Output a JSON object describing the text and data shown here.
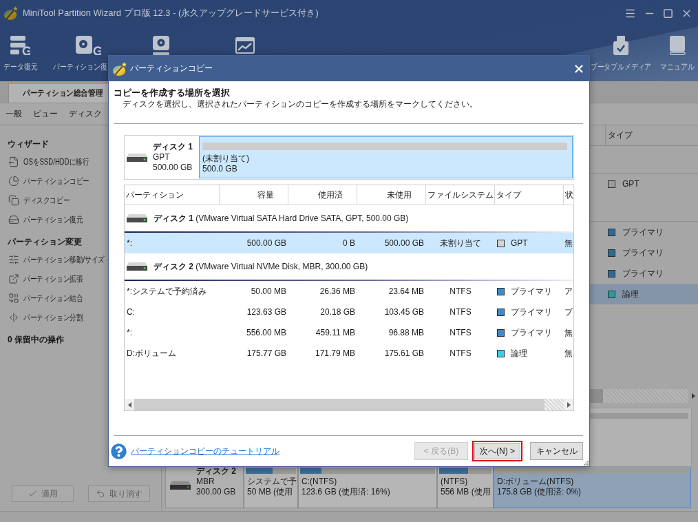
{
  "window": {
    "title": "MiniTool Partition Wizard プロ版 12.3 - (永久アップグレードサービス付き)"
  },
  "toolbar": {
    "left": [
      {
        "label": "データ復元"
      },
      {
        "label": "パーティション復"
      }
    ],
    "right": [
      {
        "label": "ブータブルメディア"
      },
      {
        "label": "マニュアル"
      }
    ]
  },
  "tabs": [
    {
      "label": "パーティション総合管理",
      "selected": true
    }
  ],
  "menu": [
    {
      "label": "一般"
    },
    {
      "label": "ビュー"
    },
    {
      "label": "ディスク"
    }
  ],
  "sidebar": {
    "sections": [
      {
        "title": "ウィザード",
        "items": [
          {
            "label": "OSをSSD/HDDに移行"
          },
          {
            "label": "パーティションコピー"
          },
          {
            "label": "ディスクコピー"
          },
          {
            "label": "パーティション復元"
          }
        ]
      },
      {
        "title": "パーティション変更",
        "items": [
          {
            "label": "パーティション移動/サイズ"
          },
          {
            "label": "パーティション拡張"
          },
          {
            "label": "パーティション結合"
          },
          {
            "label": "パーティション分割"
          }
        ]
      },
      {
        "title": "0 保留中の操作"
      }
    ],
    "actions": [
      {
        "label": "適用",
        "disabled": true
      },
      {
        "label": "取り消す",
        "disabled": true
      }
    ]
  },
  "partition_list": {
    "columns": [
      {
        "label": "タイプ"
      }
    ],
    "rows": [
      {
        "kind": "disk"
      },
      {
        "kind": "partition",
        "type": "GPT",
        "color": "#9c9c9c",
        "selected": false
      },
      {
        "kind": "disk"
      },
      {
        "kind": "partition",
        "type": "プライマリ",
        "color": "#2d6a94",
        "selected": false
      },
      {
        "kind": "partition",
        "type": "プライマリ",
        "color": "#2d6a94",
        "selected": false
      },
      {
        "kind": "partition",
        "type": "プライマリ",
        "color": "#2d6a94",
        "selected": false
      },
      {
        "kind": "partition",
        "type": "論理",
        "color": "#2a99a6",
        "selected": true
      }
    ]
  },
  "disk_map": {
    "disks": [
      {
        "partitions": [
          {
            "selected": false
          }
        ]
      },
      {
        "name": "ディスク 2",
        "scheme": "MBR",
        "size": "300.00 GB",
        "partitions": [
          {
            "label": "システムで予",
            "detail": "50 MB (使用",
            "level": 0.53,
            "selected": false
          },
          {
            "label": "C:(NTFS)",
            "detail": "123.6 GB (使用済: 16%)",
            "level": 0.16,
            "selected": false
          },
          {
            "label": "(NTFS)",
            "detail": "556 MB (使用",
            "level": 0.55,
            "selected": false
          },
          {
            "label": "D:ボリューム(NTFS)",
            "detail": "175.8 GB (使用済: 0%)",
            "selected": true
          }
        ]
      }
    ]
  },
  "dialog": {
    "title": "パーティションコピー",
    "heading": "コピーを作成する場所を選択",
    "description": "ディスクを選択し、選択されたパーティションのコピーを作成する場所をマークしてください。",
    "disk": {
      "name": "ディスク 1",
      "scheme": "GPT",
      "size": "500.00 GB",
      "segments": [
        {
          "label": "(未割り当て)",
          "size": "500.0 GB",
          "selected": true
        }
      ]
    },
    "table": {
      "columns": [
        "パーティション",
        "容量",
        "使用済",
        "未使用",
        "ファイルシステム",
        "タイプ",
        "状"
      ],
      "rows": [
        {
          "kind": "disk",
          "label": "**ディスク 1** (VMware Virtual SATA Hard Drive SATA, GPT, 500.00 GB)"
        },
        {
          "kind": "partition",
          "selected": true,
          "partition": "*:",
          "capacity": "500.00 GB",
          "used": "0 B",
          "unused": "500.00 GB",
          "file_system": "未割り当て",
          "type": "GPT",
          "color": "#d4d4d4",
          "status": "無"
        },
        {
          "kind": "disk",
          "label": "**ディスク 2** (VMware Virtual NVMe Disk, MBR, 300.00 GB)"
        },
        {
          "kind": "partition",
          "selected": false,
          "partition": "*:システムで予約済み",
          "capacity": "50.00 MB",
          "used": "26.36 MB",
          "unused": "23.64 MB",
          "file_system": "NTFS",
          "type": "プライマリ",
          "color": "#3a8ad2",
          "status": "ア"
        },
        {
          "kind": "partition",
          "selected": false,
          "partition": "C:",
          "capacity": "123.63 GB",
          "used": "20.18 GB",
          "unused": "103.45 GB",
          "file_system": "NTFS",
          "type": "プライマリ",
          "color": "#3a8ad2",
          "status": "ブ"
        },
        {
          "kind": "partition",
          "selected": false,
          "partition": "*:",
          "capacity": "556.00 MB",
          "used": "459.11 MB",
          "unused": "96.88 MB",
          "file_system": "NTFS",
          "type": "プライマリ",
          "color": "#3a8ad2",
          "status": "無"
        },
        {
          "kind": "partition",
          "selected": false,
          "partition": "D:ボリューム",
          "capacity": "175.77 GB",
          "used": "171.79 MB",
          "unused": "175.61 GB",
          "file_system": "NTFS",
          "type": "論理",
          "color": "#38d0ea",
          "status": "無"
        }
      ]
    },
    "help_link": "パーティションコピーのチュートリアル",
    "buttons": [
      {
        "label": "< 戻る(B)",
        "disabled": true,
        "highlighted": false
      },
      {
        "label": "次へ(N) >",
        "disabled": false,
        "highlighted": true
      },
      {
        "label": "キャンセル",
        "disabled": false,
        "highlighted": false
      }
    ]
  }
}
